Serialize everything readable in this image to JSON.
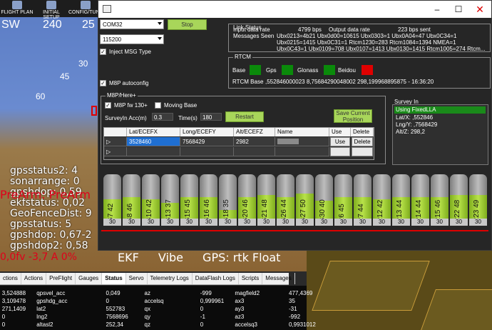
{
  "toolbar": {
    "flight_plan": "FLIGHT PLAN",
    "initial_setup": "INITIAL SETUP",
    "config_tuning": "CONFIG/TUNIN"
  },
  "hud": {
    "compass": [
      "SW",
      "240",
      "25"
    ],
    "pitch_labels": [
      "60",
      "45",
      "30"
    ],
    "lines": [
      "gpsstatus2: 4",
      "sonarrange: 0",
      "gpshdop: 0,59",
      "ekfstatus: 0,02",
      "GeoFenceDist: 9",
      "gpsstatus: 5",
      "gpshdop: 0,67-2",
      "gpshdop2: 0,58"
    ],
    "prearm": "PreArm: PreArm",
    "battery": "0,0fv -3,7 A 0%",
    "status": {
      "ekf": "EKF",
      "vibe": "Vibe",
      "gps": "GPS: rtk Float"
    }
  },
  "tabs": [
    "ctions",
    "Actions",
    "PreFlight",
    "Gauges",
    "Status",
    "Servo",
    "Telemetry Logs",
    "DataFlash Logs",
    "Scripts",
    "Messages"
  ],
  "active_tab": "Status",
  "quick_view": [
    [
      "3,524888",
      "qpsvel_acc",
      "0,049",
      "az",
      "-999",
      "magfield2",
      "477,4369"
    ],
    [
      "3,109478",
      "gpshdg_acc",
      "0",
      "accelsq",
      "0,999961",
      "ax3",
      "35"
    ],
    [
      "271,1409",
      "lat2",
      "552783",
      "qx",
      "0",
      "ay3",
      "-31"
    ],
    [
      "0",
      "lng2",
      "7568696",
      "qy",
      "-1",
      "az3",
      "-992"
    ],
    [
      "0",
      "altasl2",
      "252,34",
      "qz",
      "0",
      "accelsq3",
      "0,9931012"
    ]
  ],
  "window": {
    "port": "COM32",
    "baud": "115200",
    "stop_button": "Stop",
    "inject_msg": "Inject MSG Type",
    "m8p_autoconfig": "M8P autoconfig",
    "link_status": {
      "title": "Link Status",
      "input_rate_label": "Input data rate",
      "input_rate": "4799 bps",
      "output_rate_label": "Output data rate",
      "output_rate": "223 bps sent",
      "messages_label": "Messages Seen",
      "messages_line1": "Ubx0213=4b21 Ubx0d00=10615 Ubx0303=1 Ubx0A04=47 Ubx0C34=1",
      "messages_line2": "Ubx0215=1415 Ubx0C31=1 Rtcm1230=283 Rtcm1084=1394 NMEA=1",
      "messages_line3": "Ubx0C43=1 Ubx0109=708 Ubx0107=1413 Ubx0130=1415 Rtcm1005=274 Rtcm..."
    },
    "rtcm": {
      "title": "RTCM",
      "base": "Base",
      "gps": "Gps",
      "glonass": "Glonass",
      "beidou": "Beidou",
      "rtcm_base_label": "RTCM Base",
      "rtcm_base_value": ",552846000023 8,75684290048002 298,199968895875 - 16:36:20",
      "status_colors": {
        "base": "#0a8a0a",
        "gps": "#0a8a0a",
        "glonass": "#0a8a0a",
        "beidou": "#e00000"
      }
    },
    "m8p": {
      "title": "M8P/Here+",
      "fw": "M8P fw 130+",
      "moving_base": "Moving Base",
      "survey_acc_label": "SurveyIn Acc(m)",
      "survey_acc": "0.3",
      "time_label": "Time(s)",
      "time": "180",
      "restart": "Restart",
      "save_position": "Save Current Position"
    },
    "grid": {
      "headers": [
        "Lat/ECEFX",
        "Long/ECEFY",
        "Alt/ECEFZ",
        "Name",
        "Use",
        "Delete"
      ],
      "row": {
        "lat": "3528460",
        "lng": "7568429",
        "alt": "2982",
        "name": "",
        "use": "Use",
        "delete": "Delete"
      }
    },
    "survey_in": {
      "title": "Survey In",
      "selected": "Using FixedLLA",
      "lat": "Lat/X: ,552846",
      "lng": "Lng/Y: ,7568429",
      "alt": "Alt/Z: 298,2"
    },
    "satellites": [
      {
        "label": "G7 42",
        "level": 0.52,
        "cn": "30"
      },
      {
        "label": "G8 46",
        "level": 0.55,
        "cn": "30"
      },
      {
        "label": "G10 42",
        "level": 0.52,
        "cn": "30"
      },
      {
        "label": "G13 37",
        "level": 0.45,
        "cn": "30"
      },
      {
        "label": "G15 45",
        "level": 0.55,
        "cn": "30"
      },
      {
        "label": "G16 46",
        "level": 0.55,
        "cn": "30"
      },
      {
        "label": "G18 35",
        "level": 0.3,
        "cn": "30"
      },
      {
        "label": "G20 46",
        "level": 0.55,
        "cn": "30"
      },
      {
        "label": "G21 48",
        "level": 0.6,
        "cn": "30"
      },
      {
        "label": "G26 44",
        "level": 0.55,
        "cn": "30"
      },
      {
        "label": "G27 50",
        "level": 0.62,
        "cn": "30"
      },
      {
        "label": "G30 40",
        "level": 0.48,
        "cn": "30"
      },
      {
        "label": "R6 45",
        "level": 0.55,
        "cn": "30"
      },
      {
        "label": "R7 44",
        "level": 0.55,
        "cn": "30"
      },
      {
        "label": "R12 42",
        "level": 0.52,
        "cn": "30"
      },
      {
        "label": "R13 44",
        "level": 0.55,
        "cn": "30"
      },
      {
        "label": "R14 44",
        "level": 0.55,
        "cn": "30"
      },
      {
        "label": "R15 46",
        "level": 0.55,
        "cn": "30"
      },
      {
        "label": "R22 48",
        "level": 0.6,
        "cn": "30"
      },
      {
        "label": "R23 49",
        "level": 0.6,
        "cn": "30"
      }
    ]
  }
}
